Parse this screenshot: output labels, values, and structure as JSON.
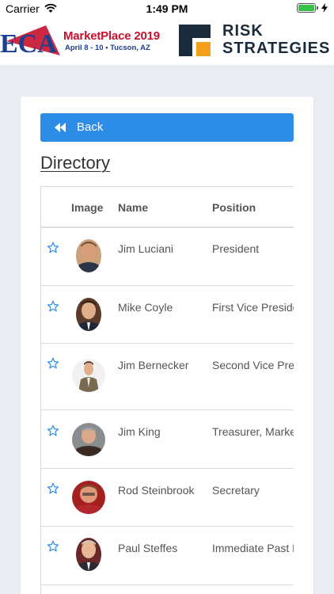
{
  "status_bar": {
    "carrier": "Carrier",
    "time": "1:49 PM"
  },
  "banner": {
    "eca_logo_text": "ECA",
    "marketplace_title": "MarketPlace 2019",
    "marketplace_subtitle": "April 8 - 10 • Tucson, AZ",
    "sponsor_line1": "RISK",
    "sponsor_line2": "STRATEGIES"
  },
  "toolbar": {
    "back_label": "Back"
  },
  "page": {
    "title": "Directory"
  },
  "table": {
    "headers": {
      "image": "Image",
      "name": "Name",
      "position": "Position"
    },
    "rows": [
      {
        "name": "Jim Luciani",
        "position": "President"
      },
      {
        "name": "Mike Coyle",
        "position": "First Vice President"
      },
      {
        "name": "Jim Bernecker",
        "position": "Second Vice President"
      },
      {
        "name": "Jim King",
        "position": "Treasurer, Marketplace"
      },
      {
        "name": "Rod Steinbrook",
        "position": "Secretary"
      },
      {
        "name": "Paul Steffes",
        "position": "Immediate Past President"
      }
    ]
  },
  "colors": {
    "accent": "#2d8ce6",
    "brand_red": "#c8102e",
    "brand_navy": "#1d3f8f",
    "sponsor_orange": "#f5a01a",
    "sponsor_dark": "#1a2c3b"
  },
  "icons": {
    "back": "double-chevron-left-icon",
    "favorite": "star-outline-icon",
    "wifi": "wifi-icon",
    "battery": "battery-icon",
    "charging": "bolt-icon"
  }
}
